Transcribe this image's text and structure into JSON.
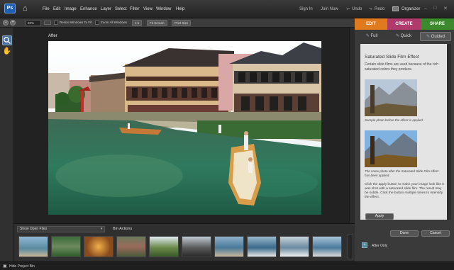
{
  "menubar": {
    "logo": "Ps",
    "items": [
      "File",
      "Edit",
      "Image",
      "Enhance",
      "Layer",
      "Select",
      "Filter",
      "View",
      "Window",
      "Help"
    ],
    "sign_in": "Sign In",
    "join_now": "Join Now",
    "undo": "Undo",
    "redo": "Redo",
    "organizer": "Organizer"
  },
  "options": {
    "zoom_value": "20%",
    "resize_windows": "Resize Windows To Fit",
    "zoom_all_windows": "Zoom All Windows",
    "one_to_one": "1:1",
    "fit_screen": "Fit Screen",
    "print_size": "Print Size"
  },
  "tabs": {
    "edit": "EDIT",
    "create": "CREATE",
    "share": "SHARE"
  },
  "modes": {
    "full": "Full",
    "quick": "Quick",
    "guided": "Guided"
  },
  "canvas": {
    "caption": "After"
  },
  "bin": {
    "dropdown": "Show Open Files",
    "actions": "Bin Actions"
  },
  "panel": {
    "title": "Saturated Slide Film Effect",
    "intro": "Certain slide films are used because of the rich saturated colors they produce.",
    "before_caption": "Sample photo before the effect is applied.",
    "after_caption": "The same photo after the Saturated Slide Film effect has been applied.",
    "instructions": "Click the apply button to make your image look like it was shot with a saturated slide film. The result may be subtle. Click the button multiple times to intensify the effect.",
    "apply": "Apply",
    "done": "Done",
    "cancel": "Cancel",
    "after_only": "After Only"
  },
  "statusbar": {
    "hide_bin": "Hide Project Bin"
  },
  "colors": {
    "edit_tab": "#e07a1f",
    "create_tab": "#b03a6c",
    "share_tab": "#3d8a2e",
    "accent": "#1e5fb4"
  }
}
